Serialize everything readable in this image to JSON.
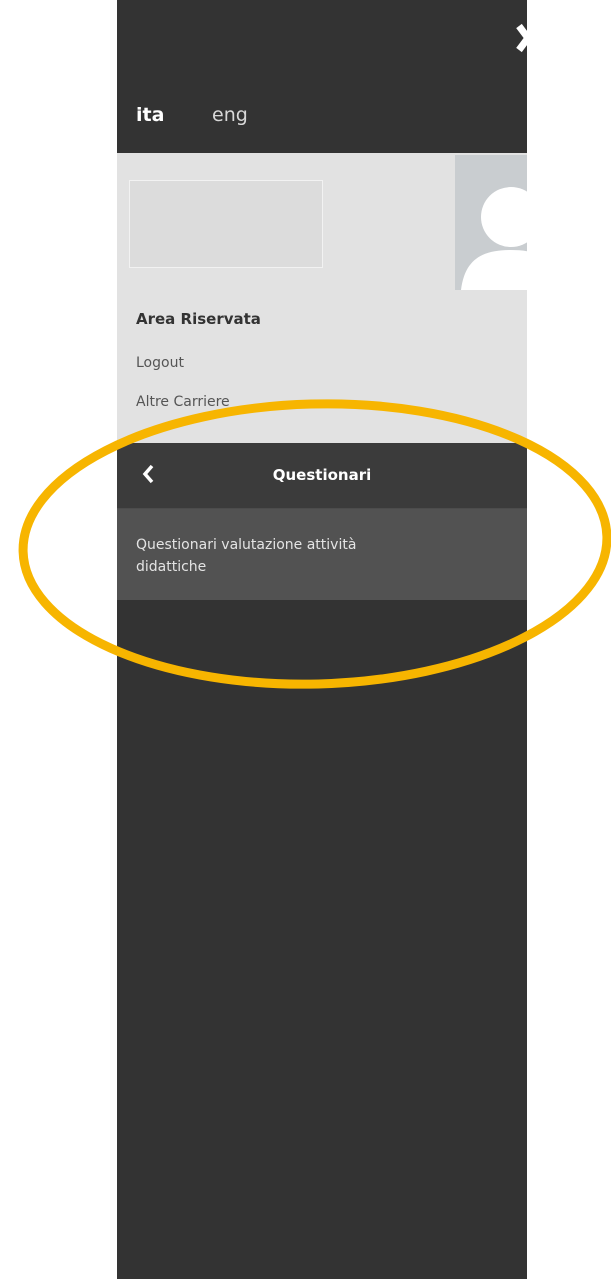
{
  "menu": {
    "languages": [
      {
        "label": "ita",
        "active": true
      },
      {
        "label": "eng",
        "active": false
      }
    ],
    "section_title": "Area Riservata",
    "links": [
      "Logout",
      "Altre Carriere"
    ],
    "submenu": {
      "title": "Questionari",
      "items": [
        "Questionari valutazione attività didattiche"
      ]
    }
  },
  "colors": {
    "panel": "#333333",
    "user_area": "#e2e2e2",
    "submenu_item": "#525252",
    "highlight": "#f7b500"
  },
  "icons": [
    "close-icon",
    "user-avatar-icon",
    "chevron-left-icon"
  ]
}
